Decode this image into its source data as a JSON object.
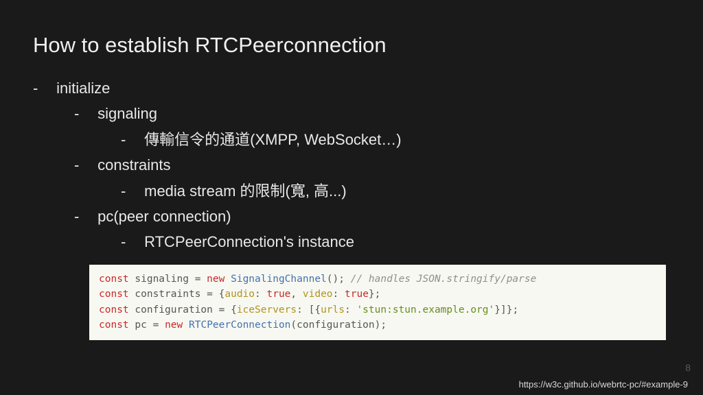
{
  "title": "How to establish RTCPeerconnection",
  "bullets": {
    "initialize": "initialize",
    "signaling": "signaling",
    "signaling_detail": "傳輸信令的通道(XMPP, WebSocket…)",
    "constraints": "constraints",
    "constraints_detail": "media stream 的限制(寬, 高...)",
    "pc": "pc(peer connection)",
    "pc_detail": "RTCPeerConnection's instance"
  },
  "code": {
    "l1": {
      "kw1": "const",
      "id": "signaling",
      "kw2": "new",
      "fn": "SignalingChannel",
      "cmt": "// handles JSON.stringify/parse"
    },
    "l2": {
      "kw1": "const",
      "id": "constraints",
      "k1": "audio",
      "v1": "true",
      "k2": "video",
      "v2": "true"
    },
    "l3": {
      "kw1": "const",
      "id": "configuration",
      "k1": "iceServers",
      "k2": "urls",
      "str": "'stun:stun.example.org'"
    },
    "l4": {
      "kw1": "const",
      "id": "pc",
      "kw2": "new",
      "fn": "RTCPeerConnection",
      "arg": "configuration"
    }
  },
  "page_number": "8",
  "source_url": "https://w3c.github.io/webrtc-pc/#example-9"
}
